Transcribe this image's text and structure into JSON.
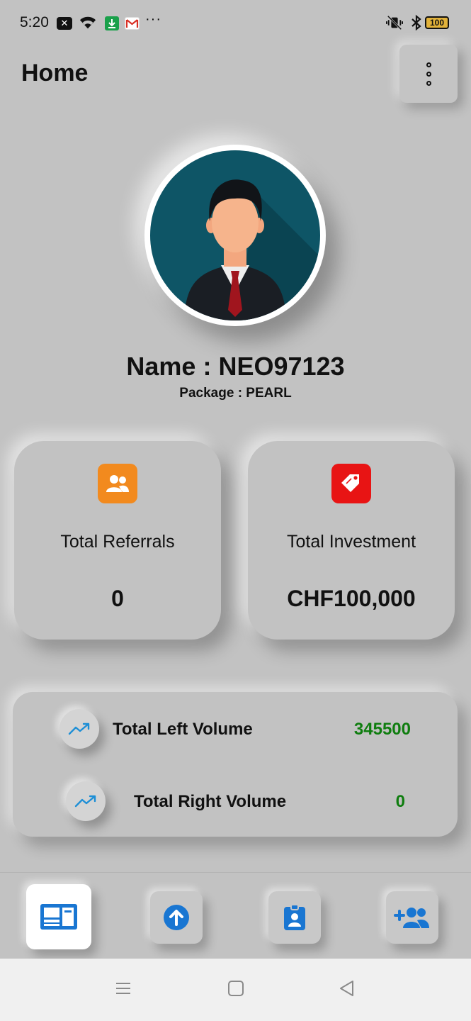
{
  "status_bar": {
    "time": "5:20",
    "more": "···",
    "battery": "100"
  },
  "header": {
    "title": "Home"
  },
  "profile": {
    "name": "Name : NEO97123",
    "package": "Package : PEARL"
  },
  "cards": [
    {
      "label": "Total Referrals",
      "value": "0",
      "icon": "users-icon",
      "color": "#f28a1e"
    },
    {
      "label": "Total Investment",
      "value": "CHF100,000",
      "icon": "tag-icon",
      "color": "#e81414"
    }
  ],
  "volumes": [
    {
      "label": "Total Left Volume",
      "value": "345500"
    },
    {
      "label": "Total Right Volume",
      "value": "0"
    }
  ],
  "colors": {
    "background": "#c2c2c2",
    "accent_blue": "#1976d2",
    "volume_green": "#0f7d0f"
  },
  "bottom_nav": [
    "dashboard-icon",
    "upload-icon",
    "profile-badge-icon",
    "add-team-icon"
  ]
}
